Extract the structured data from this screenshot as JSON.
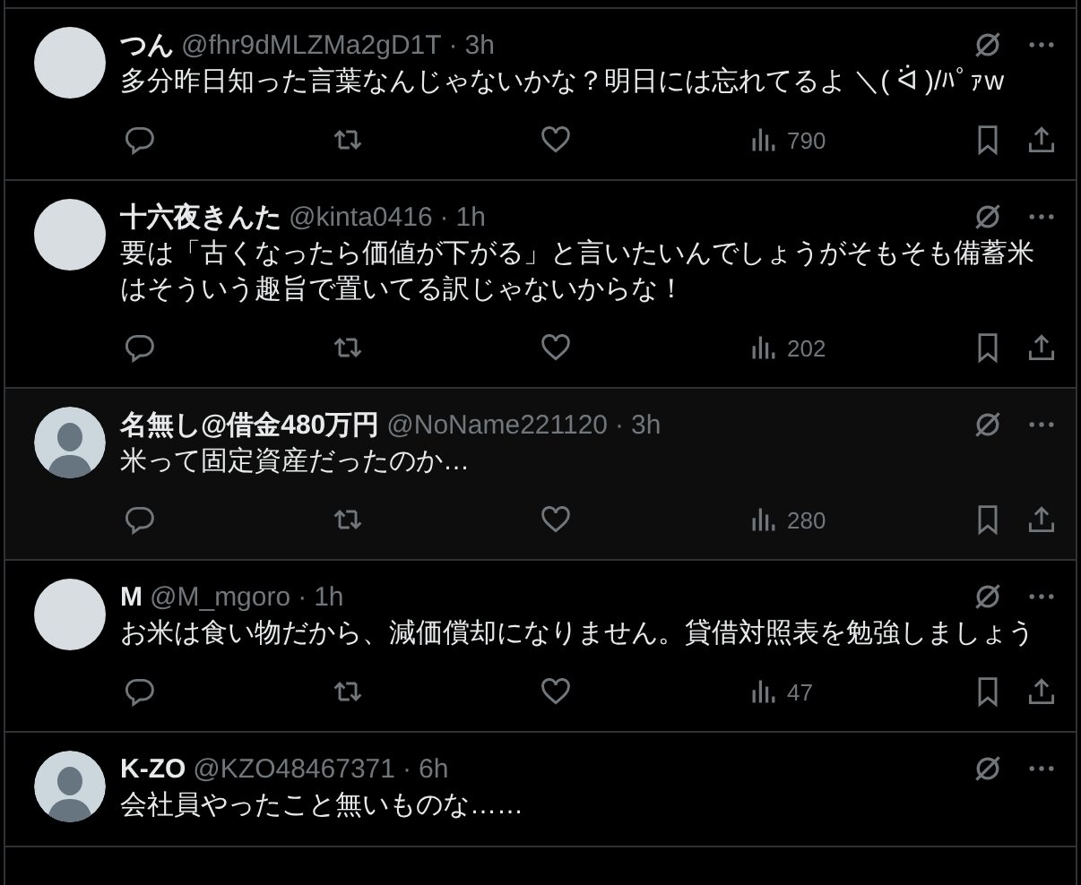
{
  "posts": [
    {
      "name": "つん",
      "handle": "@fhr9dMLZMa2gD1T",
      "separator": "·",
      "time": "3h",
      "avatar": {
        "kind": "photo"
      },
      "highlighted": false,
      "text": "多分昨日知った言葉なんじゃないかな？明日には忘れてるよ ＼( ᐛ )/ﾊﾟｧw",
      "views": "790"
    },
    {
      "name": "十六夜きんた",
      "handle": "@kinta0416",
      "separator": "·",
      "time": "1h",
      "avatar": {
        "kind": "photo"
      },
      "highlighted": false,
      "text": "要は「古くなったら価値が下がる」と言いたいんでしょうがそもそも備蓄米はそういう趣旨で置いてる訳じゃないからな！",
      "views": "202"
    },
    {
      "name": "名無し@借金480万円",
      "handle": "@NoName221120",
      "separator": "·",
      "time": "3h",
      "avatar": {
        "kind": "default"
      },
      "highlighted": true,
      "text": "米って固定資産だったのか…",
      "views": "280"
    },
    {
      "name": "M",
      "handle": "@M_mgoro",
      "separator": "·",
      "time": "1h",
      "avatar": {
        "kind": "photo"
      },
      "highlighted": false,
      "text": "お米は食い物だから、減価償却になりません。貸借対照表を勉強しましょう",
      "views": "47"
    },
    {
      "name": "K-ZO",
      "handle": "@KZO48467371",
      "separator": "·",
      "time": "6h",
      "avatar": {
        "kind": "default"
      },
      "highlighted": false,
      "text": "会社員やったこと無いものな……"
    }
  ]
}
